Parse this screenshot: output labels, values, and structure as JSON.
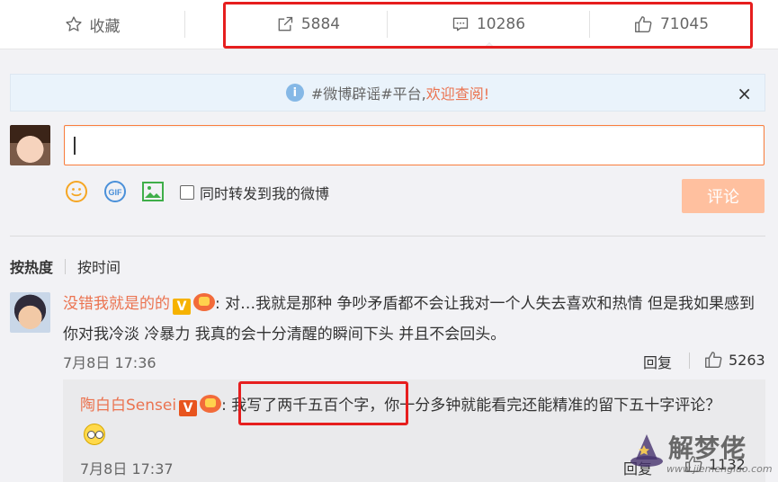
{
  "actions": {
    "favorite_label": "收藏",
    "forward_count": "5884",
    "comment_count": "10286",
    "like_count": "71045"
  },
  "notice": {
    "text": "#微博辟谣#平台,",
    "link": "欢迎查阅!",
    "close": "×"
  },
  "composer": {
    "checkbox_label": "同时转发到我的微博",
    "submit_label": "评论",
    "gif_label": "GIF"
  },
  "sort": {
    "hot": "按热度",
    "time": "按时间"
  },
  "comment": {
    "user": "没错我就是的的",
    "badge": "V",
    "text": ":  对…我就是那种  争吵矛盾都不会让我对一个人失去喜欢和热情  但是我如果感到你对我冷淡 冷暴力  我真的会十分清醒的瞬间下头  并且不会回头。",
    "time": "7月8日 17:36",
    "reply_label": "回复",
    "likes": "5263"
  },
  "reply": {
    "user": "陶白白Sensei",
    "badge": "V",
    "text": ":  我写了两千五百个字，你一分多钟就能看完还能精准的留下五十字评论？",
    "time": "7月8日 17:37",
    "reply_label": "回复",
    "likes": "1132"
  },
  "watermark": {
    "title": "解梦佬",
    "url": "www.jiemenglao.com"
  },
  "colors": {
    "accent": "#eb7350",
    "highlight_box": "#e61e1e",
    "notice_bg": "#eaf3fb",
    "submit_disabled": "#ffc09f"
  }
}
